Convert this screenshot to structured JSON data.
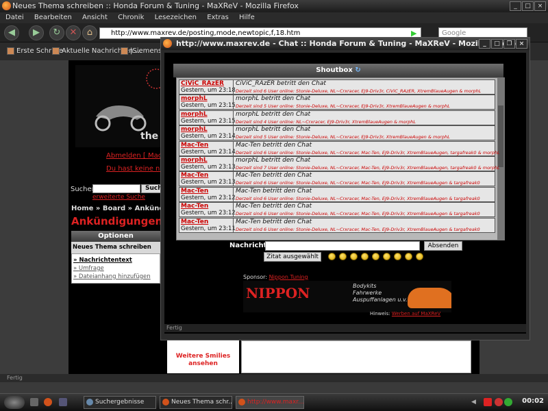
{
  "main_window": {
    "title": "Neues Thema schreiben :: Honda Forum & Tuning - MaXReV - Mozilla Firefox",
    "menu": [
      "Datei",
      "Bearbeiten",
      "Ansicht",
      "Chronik",
      "Lesezeichen",
      "Extras",
      "Hilfe"
    ],
    "url": "http://www.maxrev.de/posting,mode,newtopic,f,18.htm",
    "search_placeholder": "Google",
    "bookmarks": [
      "Erste Schritte",
      "Aktuelle Nachrichten ...",
      "|SiemensInf"
    ]
  },
  "background_page": {
    "logout": "Abmelden [ Mac-Te",
    "no_new": "Du hast keine neue",
    "search_label": "Suchen:",
    "search_button": "Such",
    "advanced_search": "erweiterte Suche",
    "breadcrumb": "Home » Board » Ankündigun",
    "heading": "Ankündigungen",
    "options_header": "Optionen",
    "new_topic": "Neues Thema schreiben",
    "options": [
      "Nachrichtentext",
      "Umfrage",
      "Dateianhang hinzufügen"
    ],
    "more_smilies": "Weitere Smilies ansehen",
    "status": "Fertig"
  },
  "chat_window": {
    "title": "http://www.maxrev.de - Chat :: Honda Forum & Tuning - MaXReV - Mozilla Firefox",
    "shoutbox_title": "Shoutbox",
    "messages": [
      {
        "user": "CiViC_RAzER",
        "time": "Gestern, um 23:18",
        "text": "CiViC_RAzER betritt den Chat",
        "info": "Derzeit sind 6 User online: Stonie-Deluxe, NL~Crxracer, EJ9-Driv3r, CiViC_RAzER, XtremBlaueAugen & morphL"
      },
      {
        "user": "morphL",
        "time": "Gestern, um 23:15",
        "text": "morphL betritt den Chat",
        "info": "Derzeit sind 5 User online: Stonie-Deluxe, NL~Crxracer, EJ9-Driv3r, XtremBlaueAugen & morphL"
      },
      {
        "user": "morphL",
        "time": "Gestern, um 23:15",
        "text": "morphL betritt den Chat",
        "info": "Derzeit sind 4 User online: NL~Crxracer, EJ9-Driv3r, XtremBlaueAugen & morphL"
      },
      {
        "user": "morphL",
        "time": "Gestern, um 23:14",
        "text": "morphL betritt den Chat",
        "info": "Derzeit sind 5 User online: Stonie-Deluxe, NL~Crxracer, EJ9-Driv3r, XtremBlaueAugen & morphL"
      },
      {
        "user": "Mac-Ten",
        "time": "Gestern, um 23:14",
        "text": "Mac-Ten betritt den Chat",
        "info": "Derzeit sind 6 User online: Stonie-Deluxe, NL~Crxracer, Mac-Ten, EJ9-Driv3r, XtremBlaueAugen, targafreak0 & morphL"
      },
      {
        "user": "morphL",
        "time": "Gestern, um 23:13",
        "text": "morphL betritt den Chat",
        "info": "Derzeit sind 7 User online: Stonie-Deluxe, NL~Crxracer, Mac-Ten, EJ9-Driv3r, XtremBlaueAugen, targafreak0 & morphL"
      },
      {
        "user": "Mac-Ten",
        "time": "Gestern, um 23:13",
        "text": "Mac-Ten betritt den Chat",
        "info": "Derzeit sind 6 User online: Stonie-Deluxe, NL~Crxracer, Mac-Ten, EJ9-Driv3r, XtremBlaueAugen & targafreak0"
      },
      {
        "user": "Mac-Ten",
        "time": "Gestern, um 23:12",
        "text": "Mac-Ten betritt den Chat",
        "info": "Derzeit sind 6 User online: Stonie-Deluxe, NL~Crxracer, Mac-Ten, EJ9-Driv3r, XtremBlaueAugen & targafreak0"
      },
      {
        "user": "Mac-Ten",
        "time": "Gestern, um 23:12",
        "text": "Mac-Ten betritt den Chat",
        "info": "Derzeit sind 6 User online: Stonie-Deluxe, NL~Crxracer, Mac-Ten, EJ9-Driv3r, XtremBlaueAugen & targafreak0"
      },
      {
        "user": "Mac-Ten",
        "time": "Gestern, um 23:11",
        "text": "Mac-Ten betritt den Chat",
        "info": "Derzeit sind 6 User online: Stonie-Deluxe, NL~Crxracer, Mac-Ten, EJ9-Driv3r, XtremBlaueAugen & targafreak0"
      }
    ],
    "nachricht_label": "Nachricht:",
    "absenden": "Absenden",
    "zitat": "Zitat ausgewählt",
    "sponsor_label": "Sponsor:",
    "sponsor_name": "Nippon Tuning",
    "ad_main": "NIPPON",
    "ad_sub": [
      "Bodykits",
      "Fahrwerke",
      "Auspuffanlagen u.v.m."
    ],
    "hinweis_label": "Hinweis:",
    "hinweis_link": "Werben auf MaXReV",
    "status": "Fertig"
  },
  "taskbar": {
    "tasks": [
      "Suchergebnisse",
      "Neues Thema schr...",
      "http://www.maxr..."
    ],
    "clock": "00:02"
  },
  "colors": {
    "accent_red": "#d22222",
    "chrome_dark": "#2b2b2b"
  }
}
